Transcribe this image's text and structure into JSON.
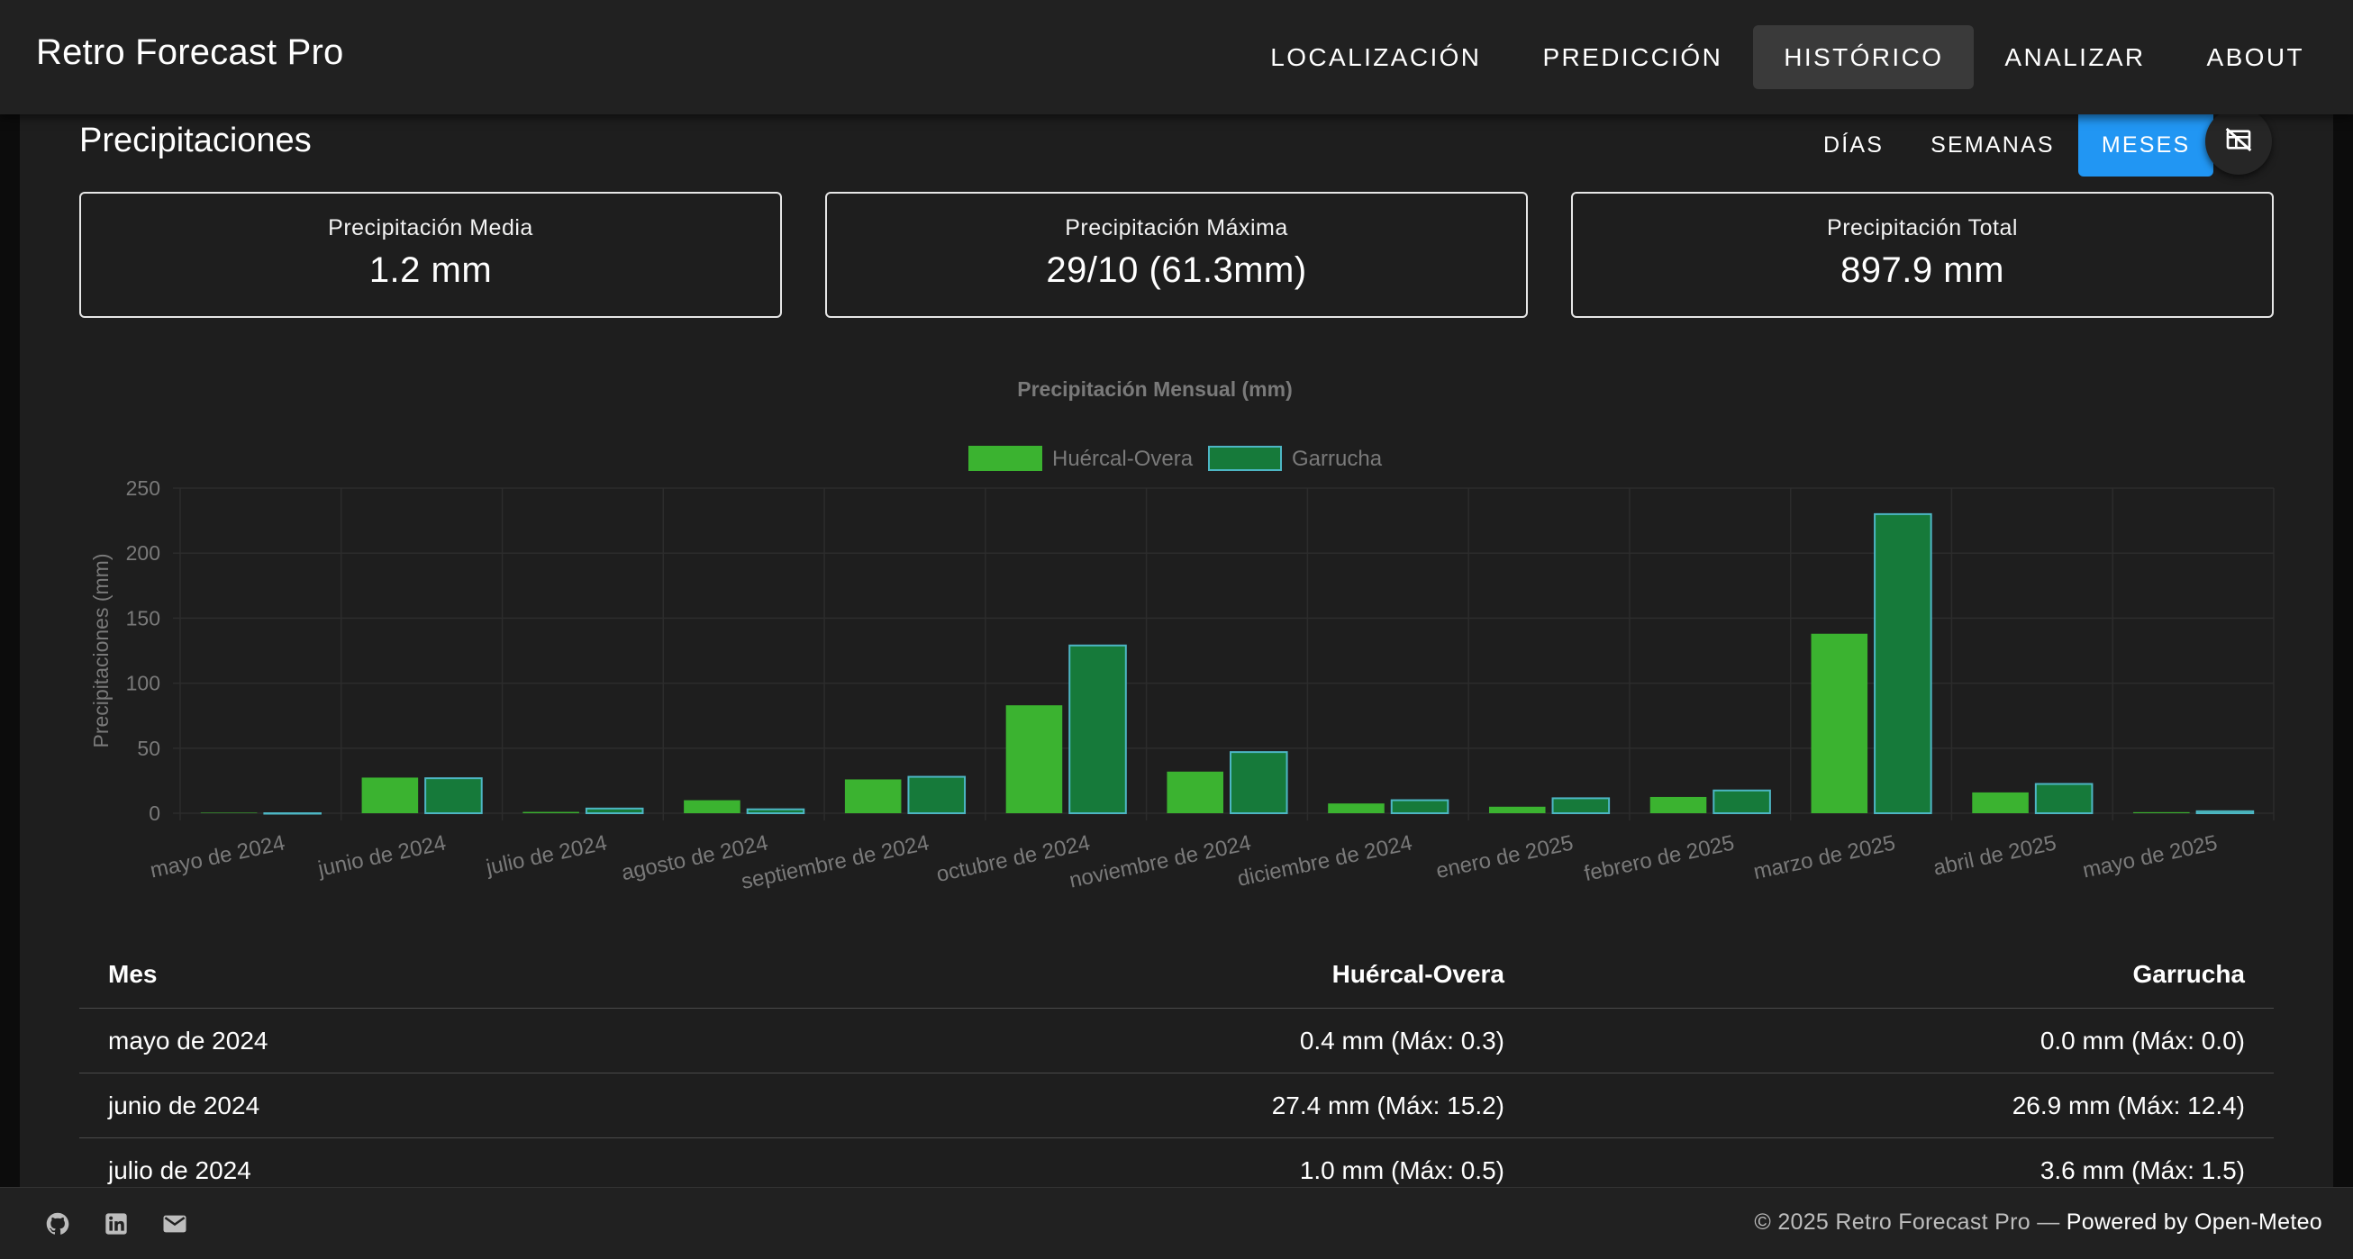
{
  "app": {
    "title": "Retro Forecast Pro"
  },
  "nav": {
    "items": [
      {
        "label": "LOCALIZACIÓN",
        "active": false
      },
      {
        "label": "PREDICCIÓN",
        "active": false
      },
      {
        "label": "HISTÓRICO",
        "active": true
      },
      {
        "label": "ANALIZAR",
        "active": false
      },
      {
        "label": "ABOUT",
        "active": false
      }
    ]
  },
  "section": {
    "title": "Precipitaciones",
    "range_buttons": [
      {
        "label": "DÍAS",
        "active": false
      },
      {
        "label": "SEMANAS",
        "active": false
      },
      {
        "label": "MESES",
        "active": true
      }
    ],
    "toggle_icon": "table-off-icon"
  },
  "stats": [
    {
      "label": "Precipitación Media",
      "value": "1.2 mm"
    },
    {
      "label": "Precipitación Máxima",
      "value": "29/10 (61.3mm)"
    },
    {
      "label": "Precipitación Total",
      "value": "897.9 mm"
    }
  ],
  "colors": {
    "accent": "#2196f3",
    "series1": "#3bb330",
    "series2": "#167a3a",
    "series2_border": "#4db6c4",
    "muted_text": "#7a7a7a",
    "grid": "#2c2c2c"
  },
  "chart_data": {
    "type": "bar",
    "title": "Precipitación Mensual (mm)",
    "ylabel": "Precipitaciones (mm)",
    "xlabel": "",
    "ylim": [
      0,
      250
    ],
    "yticks": [
      0,
      50,
      100,
      150,
      200,
      250
    ],
    "grid": true,
    "legend_position": "top-center",
    "categories": [
      "mayo de 2024",
      "junio de 2024",
      "julio de 2024",
      "agosto de 2024",
      "septiembre de 2024",
      "octubre de 2024",
      "noviembre de 2024",
      "diciembre de 2024",
      "enero de 2025",
      "febrero de 2025",
      "marzo de 2025",
      "abril de 2025",
      "mayo de 2025"
    ],
    "series": [
      {
        "name": "Huércal-Overa",
        "values": [
          0.4,
          27.4,
          1.0,
          10,
          26,
          83,
          32,
          7.5,
          5,
          12.5,
          138,
          16,
          0.8
        ]
      },
      {
        "name": "Garrucha",
        "values": [
          0.0,
          26.9,
          3.6,
          3,
          28,
          129,
          47,
          10,
          11.5,
          17.5,
          230,
          22.5,
          1.5
        ]
      }
    ]
  },
  "table": {
    "headers": [
      "Mes",
      "Huércal-Overa",
      "Garrucha"
    ],
    "rows": [
      [
        "mayo de 2024",
        "0.4 mm (Máx: 0.3)",
        "0.0 mm (Máx: 0.0)"
      ],
      [
        "junio de 2024",
        "27.4 mm (Máx: 15.2)",
        "26.9 mm (Máx: 12.4)"
      ],
      [
        "julio de 2024",
        "1.0 mm (Máx: 0.5)",
        "3.6 mm (Máx: 1.5)"
      ]
    ]
  },
  "footer": {
    "copyright": "© 2025 Retro Forecast Pro — ",
    "powered": "Powered by Open-Meteo",
    "icons": [
      "github-icon",
      "linkedin-icon",
      "email-icon"
    ]
  }
}
